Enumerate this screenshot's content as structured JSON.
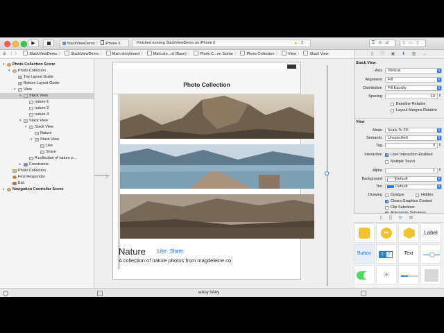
{
  "toolbar": {
    "scheme_app": "StackViewDemo",
    "scheme_device": "iPhone 6",
    "status": "Finished running StackViewDemo on iPhone 6",
    "warning_count": "1"
  },
  "jumpbar": [
    "StackViewDemo",
    "StackViewDemo",
    "Main.storyboard",
    "Main.sto...rd (Base)",
    "Photo C...on Scene",
    "Photo Collection",
    "View",
    "Stack View"
  ],
  "outline": [
    {
      "label": "Photo Collection Scene",
      "icon": "scene-icon",
      "bold": true
    },
    {
      "label": "Photo Collection",
      "icon": "view-controller-icon"
    },
    {
      "label": "Top Layout Guide",
      "icon": "layout-guide-icon"
    },
    {
      "label": "Bottom Layout Guide",
      "icon": "layout-guide-icon"
    },
    {
      "label": "View",
      "icon": "view-icon"
    },
    {
      "label": "Stack View",
      "icon": "stack-view-icon",
      "selected": true
    },
    {
      "label": "nature-1",
      "icon": "image-view-icon"
    },
    {
      "label": "nature-2",
      "icon": "image-view-icon"
    },
    {
      "label": "nature-3",
      "icon": "image-view-icon"
    },
    {
      "label": "Stack View",
      "icon": "stack-view-icon"
    },
    {
      "label": "Stack View",
      "icon": "stack-view-icon"
    },
    {
      "label": "Nature",
      "icon": "label-icon"
    },
    {
      "label": "Stack View",
      "icon": "stack-view-icon"
    },
    {
      "label": "Like",
      "icon": "label-icon"
    },
    {
      "label": "Share",
      "icon": "label-icon"
    },
    {
      "label": "A collection of nature p...",
      "icon": "label-icon"
    },
    {
      "label": "Constraints",
      "icon": "constraints-icon"
    },
    {
      "label": "Photo Collection",
      "icon": "navigation-item-icon"
    },
    {
      "label": "First Responder",
      "icon": "first-responder-icon"
    },
    {
      "label": "Exit",
      "icon": "exit-icon"
    },
    {
      "label": "Navigation Controller Scene",
      "icon": "scene-icon",
      "bold": true
    }
  ],
  "canvas": {
    "nav_title": "Photo Collection",
    "heading": "Nature",
    "like": "Like",
    "share": "Share",
    "caption": "A collection of nature photos from magdeleine.co"
  },
  "inspector": {
    "stack_title": "Stack View",
    "axis_label": "Axis",
    "axis_value": "Vertical",
    "alignment_label": "Alignment",
    "alignment_value": "Fill",
    "distribution_label": "Distribution",
    "distribution_value": "Fill Equally",
    "spacing_label": "Spacing",
    "spacing_value": "10",
    "baseline_label": "Baseline Relative",
    "margins_label": "Layout Margins Relative",
    "view_title": "View",
    "mode_label": "Mode",
    "mode_value": "Scale To Fill",
    "semantic_label": "Semantic",
    "semantic_value": "Unspecified",
    "tag_label": "Tag",
    "tag_value": "0",
    "interaction_label": "Interaction",
    "user_interaction_label": "User Interaction Enabled",
    "multiple_touch_label": "Multiple Touch",
    "alpha_label": "Alpha",
    "alpha_value": "1",
    "background_label": "Background",
    "background_value": "Default",
    "tint_label": "Tint",
    "tint_value": "Default",
    "drawing_label": "Drawing",
    "opaque_label": "Opaque",
    "hidden_label": "Hidden",
    "clears_label": "Clears Graphics Context",
    "clip_label": "Clip Subviews",
    "autoresize_label": "Autoresize Subviews"
  },
  "library": {
    "label_text": "Label",
    "button_text": "Button",
    "seg1": "1",
    "seg2": "2",
    "text_text": "Text"
  },
  "bottombar": {
    "size_class": "wAny hAny"
  },
  "colors": {
    "accent": "#2f7de1",
    "warning": "#f2b705",
    "selection": "#d0d0d0"
  }
}
